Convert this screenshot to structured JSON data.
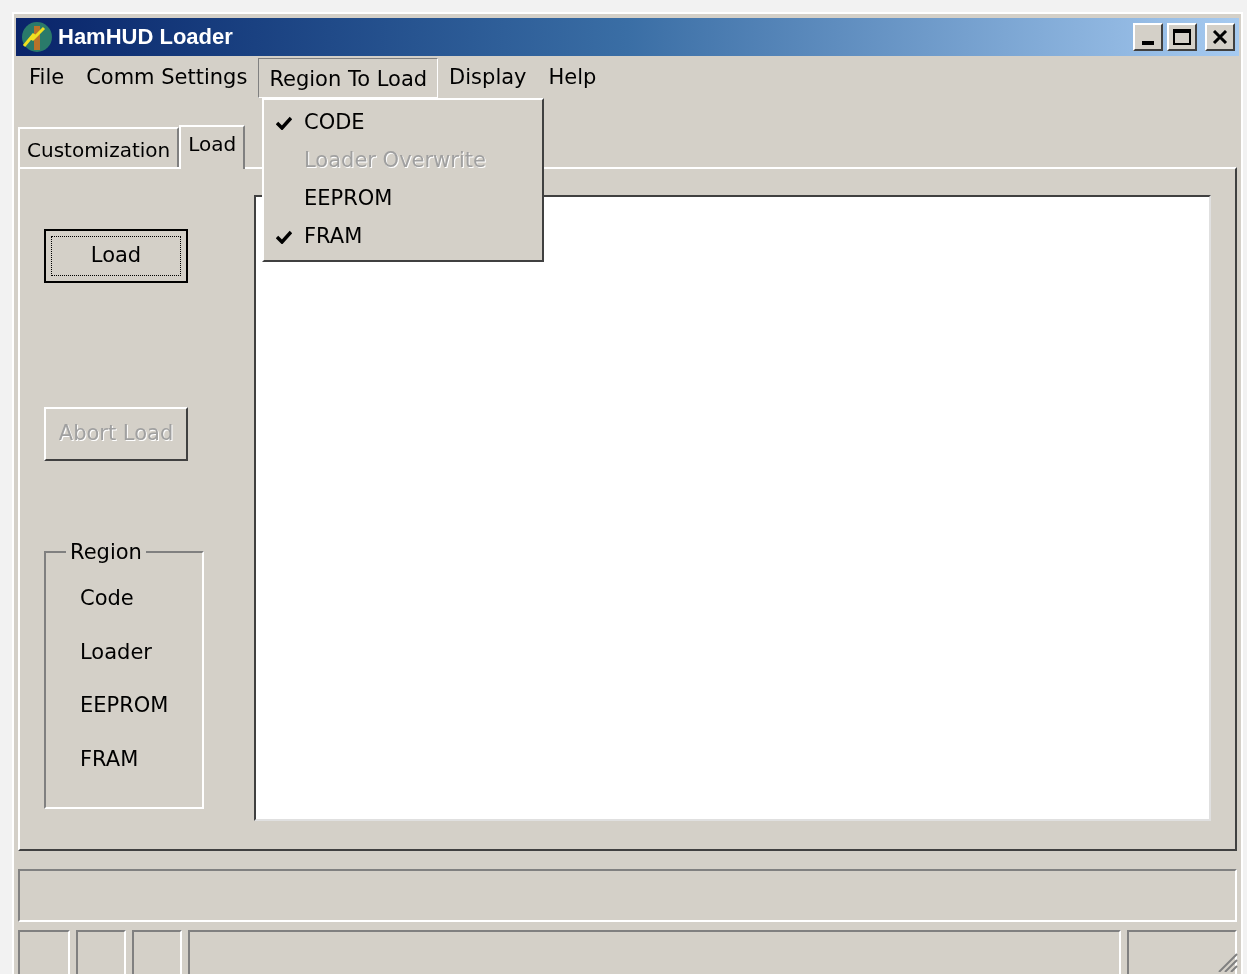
{
  "window": {
    "title": "HamHUD Loader"
  },
  "menu": [
    {
      "label": "File",
      "selected": false
    },
    {
      "label": "Comm Settings",
      "selected": false
    },
    {
      "label": "Region To Load",
      "selected": true
    },
    {
      "label": "Display",
      "selected": false
    },
    {
      "label": "Help",
      "selected": false
    }
  ],
  "dropdown": [
    {
      "label": "CODE",
      "checked": true,
      "disabled": false
    },
    {
      "label": "Loader Overwrite",
      "checked": false,
      "disabled": true
    },
    {
      "label": "EEPROM",
      "checked": false,
      "disabled": false
    },
    {
      "label": "FRAM",
      "checked": true,
      "disabled": false
    }
  ],
  "tabs": [
    {
      "label": "Customization",
      "selected": false
    },
    {
      "label": "Load",
      "selected": true
    }
  ],
  "buttons": [
    {
      "label": "Load",
      "disabled": false,
      "focused": true
    },
    {
      "label": "Abort Load",
      "disabled": true,
      "focused": false
    }
  ],
  "region_group": {
    "title": "Region",
    "items": [
      "Code",
      "Loader",
      "EEPROM",
      "FRAM"
    ]
  }
}
